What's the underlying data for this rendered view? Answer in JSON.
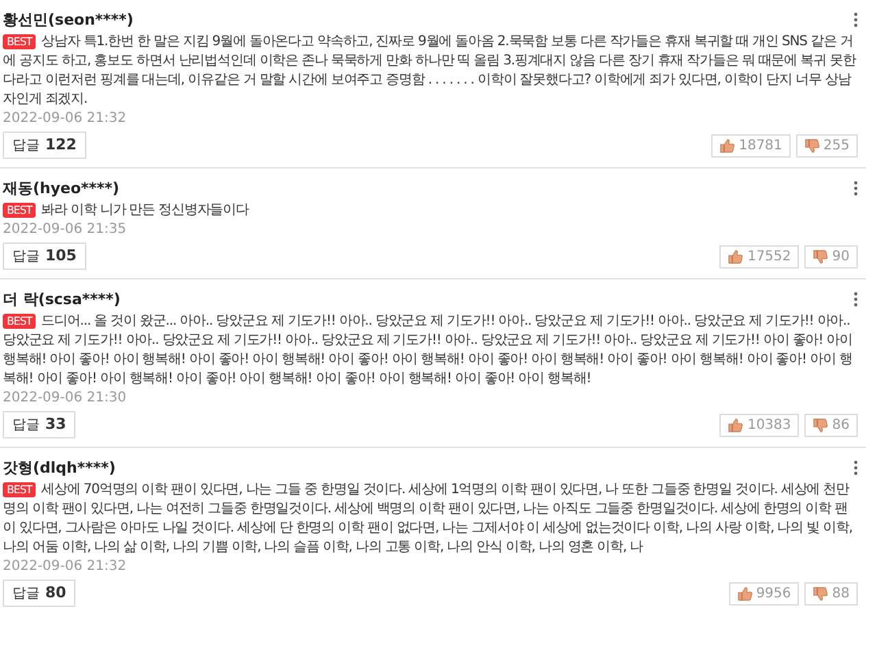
{
  "comments": [
    {
      "author": "황선민(seon****)",
      "badge": "BEST",
      "text": "상남자 특1.한번 한 말은 지킴 9월에 돌아온다고 약속하고, 진짜로 9월에 돌아옴 2.묵묵함 보통 다른 작가들은 휴재 복귀할 때 개인 SNS 같은 거에 공지도 하고, 홍보도 하면서 난리법석인데 이학은 존나 묵묵하게 만화 하나만 띡 올림 3.핑계대지 않음 다른 장기 휴재 작가들은 뭐 때문에 복귀 못한다라고 이런저런 핑계를 대는데, 이유같은 거 말할 시간에 보여주고 증명함 . . . . . . . 이학이 잘못했다고? 이학에게 죄가 있다면, 이학이 단지 너무 상남자인게 죄겠지.",
      "date": "2022-09-06 21:32",
      "reply_label": "답글",
      "reply_count": "122",
      "likes": "18781",
      "dislikes": "255"
    },
    {
      "author": "재동(hyeo****)",
      "badge": "BEST",
      "text": "봐라 이학 니가 만든 정신병자들이다",
      "date": "2022-09-06 21:35",
      "reply_label": "답글",
      "reply_count": "105",
      "likes": "17552",
      "dislikes": "90"
    },
    {
      "author": "더 락(scsa****)",
      "badge": "BEST",
      "text": "드디어... 올 것이 왔군... 아아.. 당았군요 제 기도가!! 아아.. 당았군요 제 기도가!! 아아.. 당았군요 제 기도가!! 아아.. 당았군요 제 기도가!! 아아.. 당았군요 제 기도가!! 아아.. 당았군요 제 기도가!! 아아.. 당았군요 제 기도가!! 아아.. 당았군요 제 기도가!! 아아.. 당았군요 제 기도가!! 아이 좋아! 아이 행복해! 아이 좋아! 아이 행복해! 아이 좋아! 아이 행복해! 아이 좋아! 아이 행복해! 아이 좋아! 아이 행복해! 아이 좋아! 아이 행복해! 아이 좋아! 아이 행복해! 아이 좋아! 아이 행복해! 아이 좋아! 아이 행복해! 아이 좋아! 아이 행복해! 아이 좋아! 아이 행복해!",
      "date": "2022-09-06 21:30",
      "reply_label": "답글",
      "reply_count": "33",
      "likes": "10383",
      "dislikes": "86"
    },
    {
      "author": "갓형(dlqh****)",
      "badge": "BEST",
      "text": "세상에 70억명의 이학 팬이 있다면, 나는 그들 중 한명일 것이다. 세상에 1억명의 이학 팬이 있다면, 나 또한 그들중 한명일 것이다. 세상에 천만명의 이학 팬이 있다면, 나는 여전히 그들중 한명일것이다. 세상에 백명의 이학 팬이 있다면, 나는 아직도 그들중 한명일것이다. 세상에 한명의 이학 팬이 있다면, 그사람은 아마도 나일 것이다. 세상에 단 한명의 이학 팬이 없다면, 나는 그제서야 이 세상에 없는것이다 이학, 나의 사랑 이학, 나의 빛 이학, 나의 어둠 이학, 나의 삶 이학, 나의 기쁨 이학, 나의 슬픔 이학, 나의 고통 이학, 나의 안식 이학, 나의 영혼 이학, 나",
      "date": "2022-09-06 21:32",
      "reply_label": "답글",
      "reply_count": "80",
      "likes": "9956",
      "dislikes": "88"
    }
  ]
}
